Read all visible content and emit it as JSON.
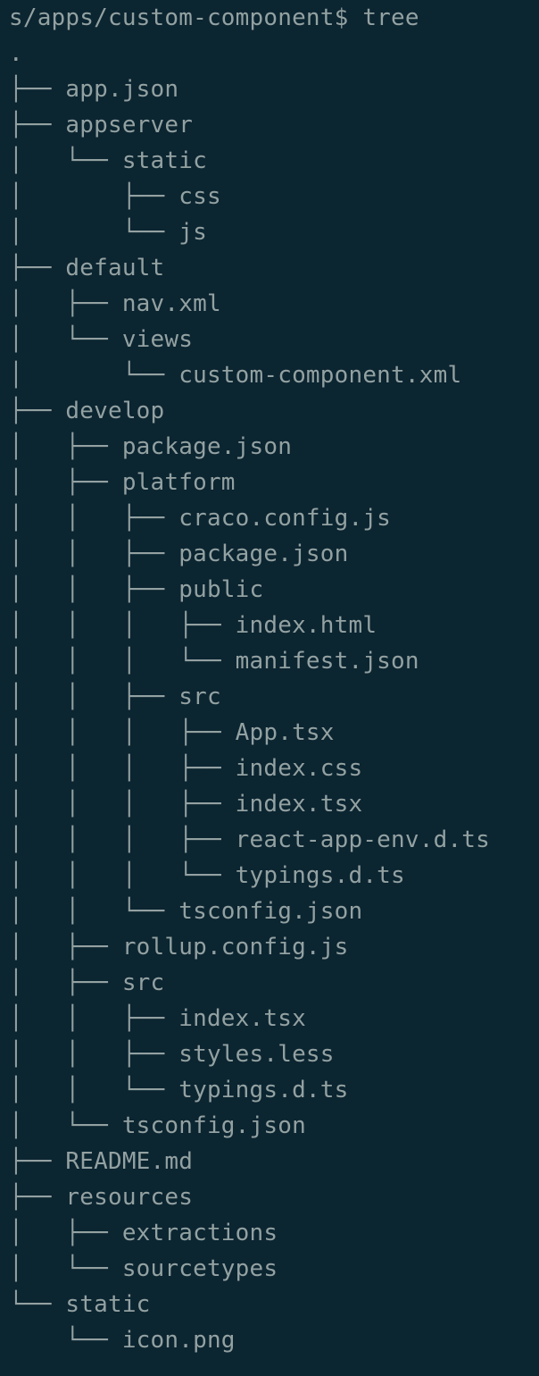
{
  "theme": {
    "background": "#0b2531",
    "foreground": "#93a1a1"
  },
  "terminal": {
    "prompt_line": "s/apps/custom-component$ tree",
    "lines": [
      ".",
      "├── app.json",
      "├── appserver",
      "│   └── static",
      "│       ├── css",
      "│       └── js",
      "├── default",
      "│   ├── nav.xml",
      "│   └── views",
      "│       └── custom-component.xml",
      "├── develop",
      "│   ├── package.json",
      "│   ├── platform",
      "│   │   ├── craco.config.js",
      "│   │   ├── package.json",
      "│   │   ├── public",
      "│   │   │   ├── index.html",
      "│   │   │   └── manifest.json",
      "│   │   ├── src",
      "│   │   │   ├── App.tsx",
      "│   │   │   ├── index.css",
      "│   │   │   ├── index.tsx",
      "│   │   │   ├── react-app-env.d.ts",
      "│   │   │   └── typings.d.ts",
      "│   │   └── tsconfig.json",
      "│   ├── rollup.config.js",
      "│   ├── src",
      "│   │   ├── index.tsx",
      "│   │   ├── styles.less",
      "│   │   └── typings.d.ts",
      "│   └── tsconfig.json",
      "├── README.md",
      "├── resources",
      "│   ├── extractions",
      "│   └── sourcetypes",
      "└── static",
      "    └── icon.png"
    ]
  }
}
